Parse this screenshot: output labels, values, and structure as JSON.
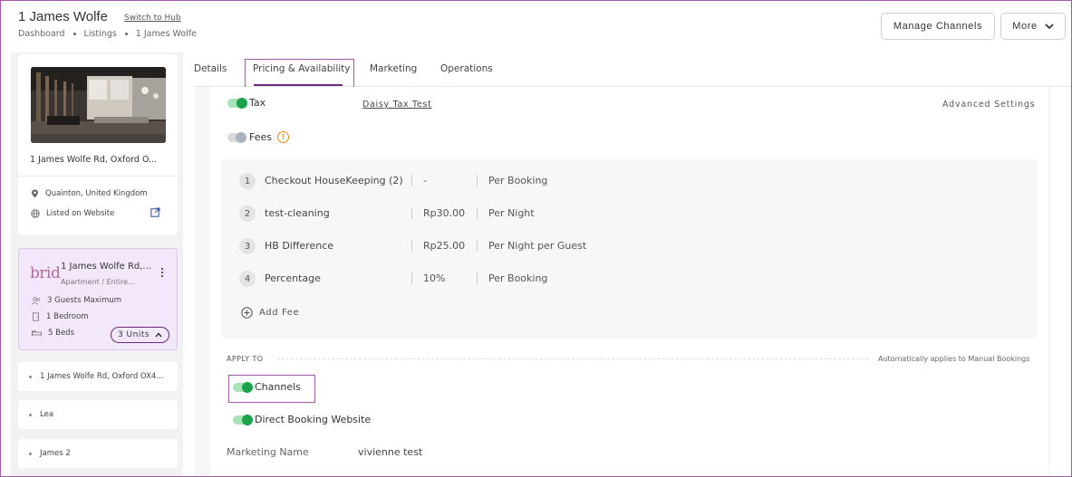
{
  "header": {
    "title": "1 James Wolfe",
    "switch_link": "Switch to Hub",
    "breadcrumb": [
      "Dashboard",
      "Listings",
      "1 James Wolfe"
    ],
    "manage_channels": "Manage Channels",
    "more": "More"
  },
  "sidebar": {
    "property": {
      "address": "1 James Wolfe Rd, Oxford O...",
      "location": "Quainton, United Kingdom",
      "listed": "Listed on Website"
    },
    "unit": {
      "logo_text": "brid",
      "title": "1 James Wolfe Rd,...",
      "subtitle": "Apartment / Entire...",
      "guests": "3 Guests Maximum",
      "bedrooms": "1 Bedroom",
      "beds": "5 Beds",
      "units_button": "3 Units"
    },
    "list": [
      "1 James Wolfe Rd, Oxford OX4...",
      "Lea",
      "James 2"
    ]
  },
  "tabs": [
    "Details",
    "Pricing & Availability",
    "Marketing",
    "Operations"
  ],
  "pricing": {
    "tax_label": "Tax",
    "tax_link": "Daisy Tax Test",
    "advanced": "Advanced Settings",
    "fees_label": "Fees",
    "warn_symbol": "!",
    "fees": [
      {
        "num": "1",
        "name": "Checkout HouseKeeping (2)",
        "amount": "-",
        "type": "Per Booking"
      },
      {
        "num": "2",
        "name": "test-cleaning",
        "amount": "Rp30.00",
        "type": "Per Night"
      },
      {
        "num": "3",
        "name": "HB Difference",
        "amount": "Rp25.00",
        "type": "Per Night per Guest"
      },
      {
        "num": "4",
        "name": "Percentage",
        "amount": "10%",
        "type": "Per Booking"
      }
    ],
    "add_fee": "Add Fee",
    "apply_to": "APPLY TO",
    "apply_note": "Automatically applies to Manual Bookings",
    "channels": "Channels",
    "direct": "Direct Booking Website",
    "marketing_label": "Marketing Name",
    "marketing_value": "vivienne test"
  },
  "colors": {
    "accent": "#6b2a7a",
    "toggle_on": "#1aa34a",
    "warning": "#f08a1a",
    "unit_card": "#f3e8fb"
  }
}
